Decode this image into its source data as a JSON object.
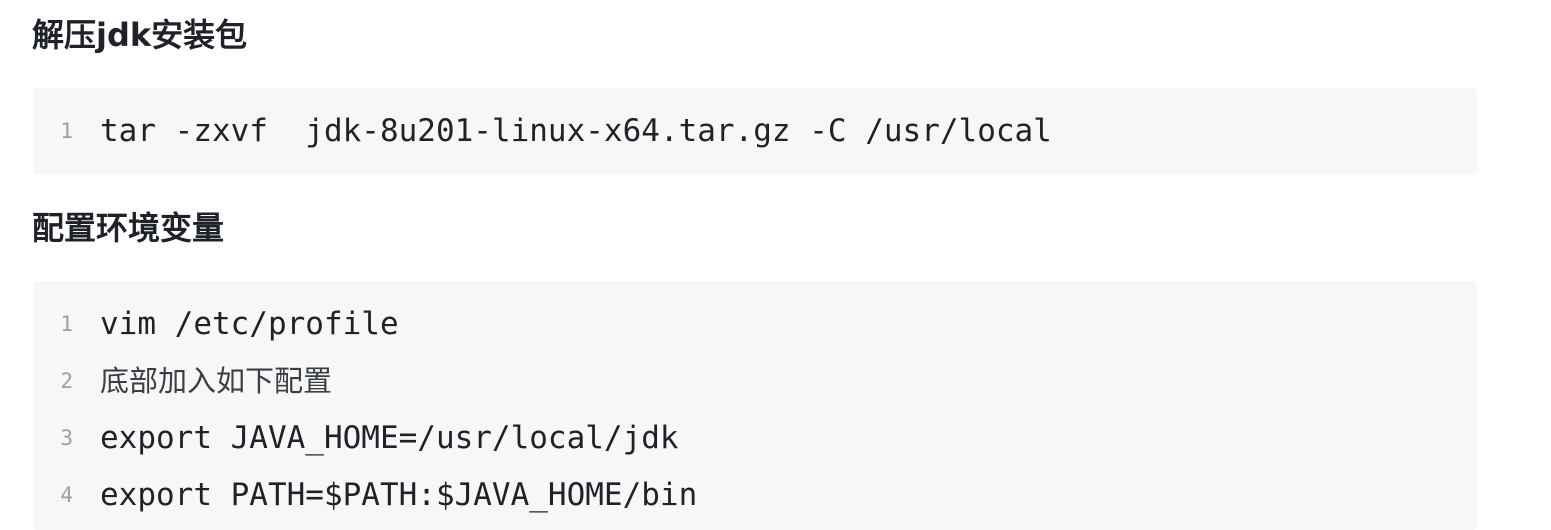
{
  "sections": [
    {
      "heading": "解压jdk安装包",
      "code": [
        {
          "num": "1",
          "text": "tar -zxvf  jdk-8u201-linux-x64.tar.gz -C /usr/local"
        }
      ]
    },
    {
      "heading": "配置环境变量",
      "code": [
        {
          "num": "1",
          "text": "vim /etc/profile"
        },
        {
          "num": "2",
          "text": "底部加入如下配置"
        },
        {
          "num": "3",
          "text": "export JAVA_HOME=/usr/local/jdk"
        },
        {
          "num": "4",
          "text": "export PATH=$PATH:$JAVA_HOME/bin"
        }
      ]
    }
  ]
}
